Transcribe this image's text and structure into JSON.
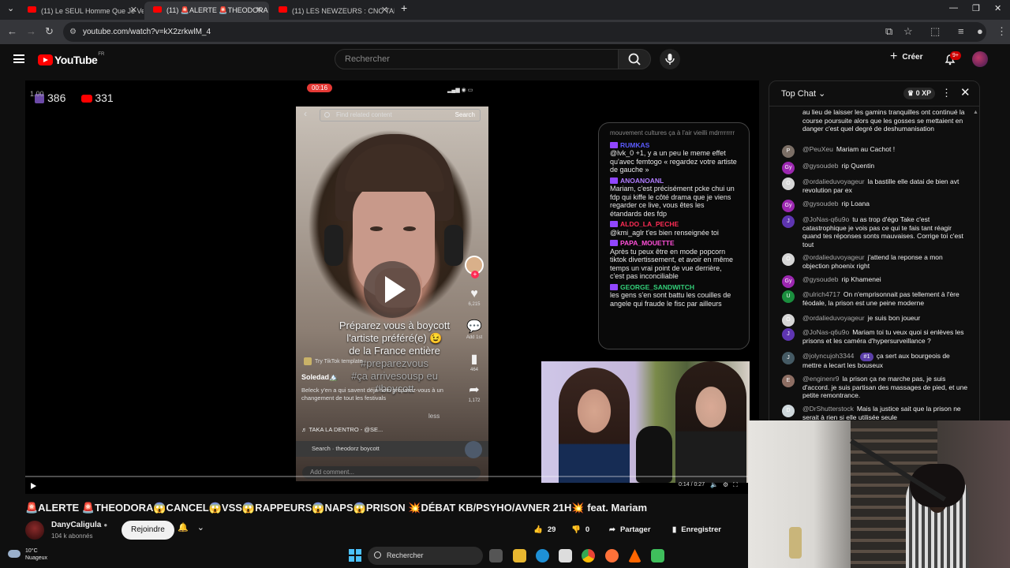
{
  "browser": {
    "tabs": [
      {
        "label": "(11) Le SEUL Homme Que Je Veux",
        "active": false
      },
      {
        "label": "(11) 🚨ALERTE 🚨THEODORA",
        "active": true
      },
      {
        "label": "(11) LES NEWZEURS : CNC TALK",
        "active": false
      }
    ],
    "new_tab": "+",
    "url": "youtube.com/watch?v=kX2zrkwlM_4"
  },
  "youtube": {
    "logo_text": "YouTube",
    "country_code": "FR",
    "search_placeholder": "Rechercher",
    "create_label": "Créer",
    "notif_badge": "9+"
  },
  "stream_overlay": {
    "small_label": "1.00",
    "twitch_viewers": "386",
    "youtube_viewers": "331",
    "rec_time": "00:16"
  },
  "tiktok": {
    "search_placeholder": "Find related content",
    "search_button": "Search",
    "caption_lines": [
      "Préparez vous à boycott",
      "l'artiste préféré(e) 😉",
      "de la France entière"
    ],
    "hashtags": [
      "#preparezvous",
      "#ça arrivesousp eu",
      "#boycott"
    ],
    "template_label": "Try TikTok template",
    "username": "Soledad🏔️",
    "description": "Beleck y'en a qui savent déjà hein préparez-vous à un changement de tout les festivals",
    "less": "less",
    "sound": "♬ TAKA LA DENTRO - @SE...",
    "search_suggestion": "Search · theodorz boycott",
    "comment_placeholder": "Add comment...",
    "likes": "6,215",
    "comments_label": "Add 1st",
    "saves": "464",
    "shares": "1,172"
  },
  "twitch_chat": {
    "faded_top": "mouvement cultures ça à l'air vieilli mdrrrrrrrr",
    "messages": [
      {
        "name": "RUMKAS",
        "color": "#5b5bff",
        "text": "@lvk_0 +1, y a un peu le meme effet qu'avec femtogo « regardez votre artiste de gauche »"
      },
      {
        "name": "ANOANOANL",
        "color": "#b07cff",
        "text": "Mariam, c'est précisément pcke chui un fdp qui kiffe le côté drama que je viens regarder ce live, vous êtes les étandards des fdp"
      },
      {
        "name": "ALDO_LA_PECHE",
        "color": "#ff2c55",
        "text": "@kmi_aglr t'es bien renseignée toi"
      },
      {
        "name": "PAPA_MOUETTE",
        "color": "#ff4fd8",
        "text": "Après tu peux être en mode popcorn tiktok divertissement, et avoir en même temps un vrai point de vue derrière, c'est pas inconciliable"
      },
      {
        "name": "GEORGE_SANDWITCH",
        "color": "#33d17a",
        "text": "les gens s'en sont battu les couilles de angele qui fraude le fisc par ailleurs"
      }
    ]
  },
  "player": {
    "time": "0:14 / 0:27"
  },
  "video": {
    "title": "🚨ALERTE 🚨THEODORA😱CANCEL😱VSS😱RAPPEURS😱NAPS😱PRISON 💥DÉBAT KB/PSYHO/AVNER 21H💥 feat. Mariam",
    "channel": "DanyCaligula",
    "subscribers": "104 k abonnés",
    "join_label": "Rejoindre",
    "likes": "29",
    "dislikes": "0",
    "share_label": "Partager",
    "save_label": "Enregistrer"
  },
  "chat": {
    "title": "Top Chat",
    "xp": "0 XP",
    "messages": [
      {
        "author": "",
        "initial": "",
        "color": "#0f0f0f",
        "text": "au lieu de laisser les gamins tranquilles ont continué la course poursuite alors que les gosses se mettaient en danger c'est quel degré de deshumanisation",
        "badge": ""
      },
      {
        "author": "@PeuXeu",
        "initial": "P",
        "color": "#7b6f66",
        "text": "Mariam au Cachot !",
        "badge": ""
      },
      {
        "author": "@gysoudeb",
        "initial": "Gy",
        "color": "#9c27b0",
        "text": "rip Quentin",
        "badge": ""
      },
      {
        "author": "@ordalieduvoyageur",
        "initial": "O",
        "color": "#d6d6d6",
        "text": "la bastille elle datai de bien avt revolution par ex",
        "badge": ""
      },
      {
        "author": "@gysoudeb",
        "initial": "Gy",
        "color": "#9c27b0",
        "text": "rip Loana",
        "badge": ""
      },
      {
        "author": "@JoNas-q6u9o",
        "initial": "J",
        "color": "#5e35b1",
        "text": "tu as trop d'égo Take c'est catastrophique je vois pas ce qui te fais tant réagir quand tes réponses sonts mauvaises. Corrige toi c'est tout",
        "badge": ""
      },
      {
        "author": "@ordalieduvoyageur",
        "initial": "O",
        "color": "#d6d6d6",
        "text": "j'attend la reponse a mon objection phoenix right",
        "badge": ""
      },
      {
        "author": "@gysoudeb",
        "initial": "Gy",
        "color": "#9c27b0",
        "text": "rip Khamenei",
        "badge": ""
      },
      {
        "author": "@ulrich4717",
        "initial": "U",
        "color": "#1b8e3e",
        "text": "On n'emprisonnait pas tellement à l'ère féodale, la prison est une peine moderne",
        "badge": ""
      },
      {
        "author": "@ordalieduvoyageur",
        "initial": "O",
        "color": "#d6d6d6",
        "text": "je suis bon joueur",
        "badge": ""
      },
      {
        "author": "@JoNas-q6u9o",
        "initial": "J",
        "color": "#5e35b1",
        "text": "Mariam toi tu veux quoi si enlèves les prisons et les caméra d'hypersurveillance ?",
        "badge": ""
      },
      {
        "author": "@jolyncujoh3344",
        "initial": "J",
        "color": "#455a64",
        "text": "ça sert aux bourgeois de mettre a lecart les bouseux",
        "badge": "#1"
      },
      {
        "author": "@enginenr9",
        "initial": "E",
        "color": "#8d6e63",
        "text": "la prison ça ne marche pas, je suis d'accord. je suis partisan des massages de pied, et une petite remontrance.",
        "badge": ""
      },
      {
        "author": "@DrShutterstock",
        "initial": "D",
        "color": "#cfd8dc",
        "text": "Mais la justice sait que la prison ne serait à rien si elle utilisée seule",
        "badge": ""
      }
    ]
  },
  "taskbar": {
    "temperature": "10°C",
    "weather": "Nuageux",
    "search_label": "Rechercher"
  }
}
